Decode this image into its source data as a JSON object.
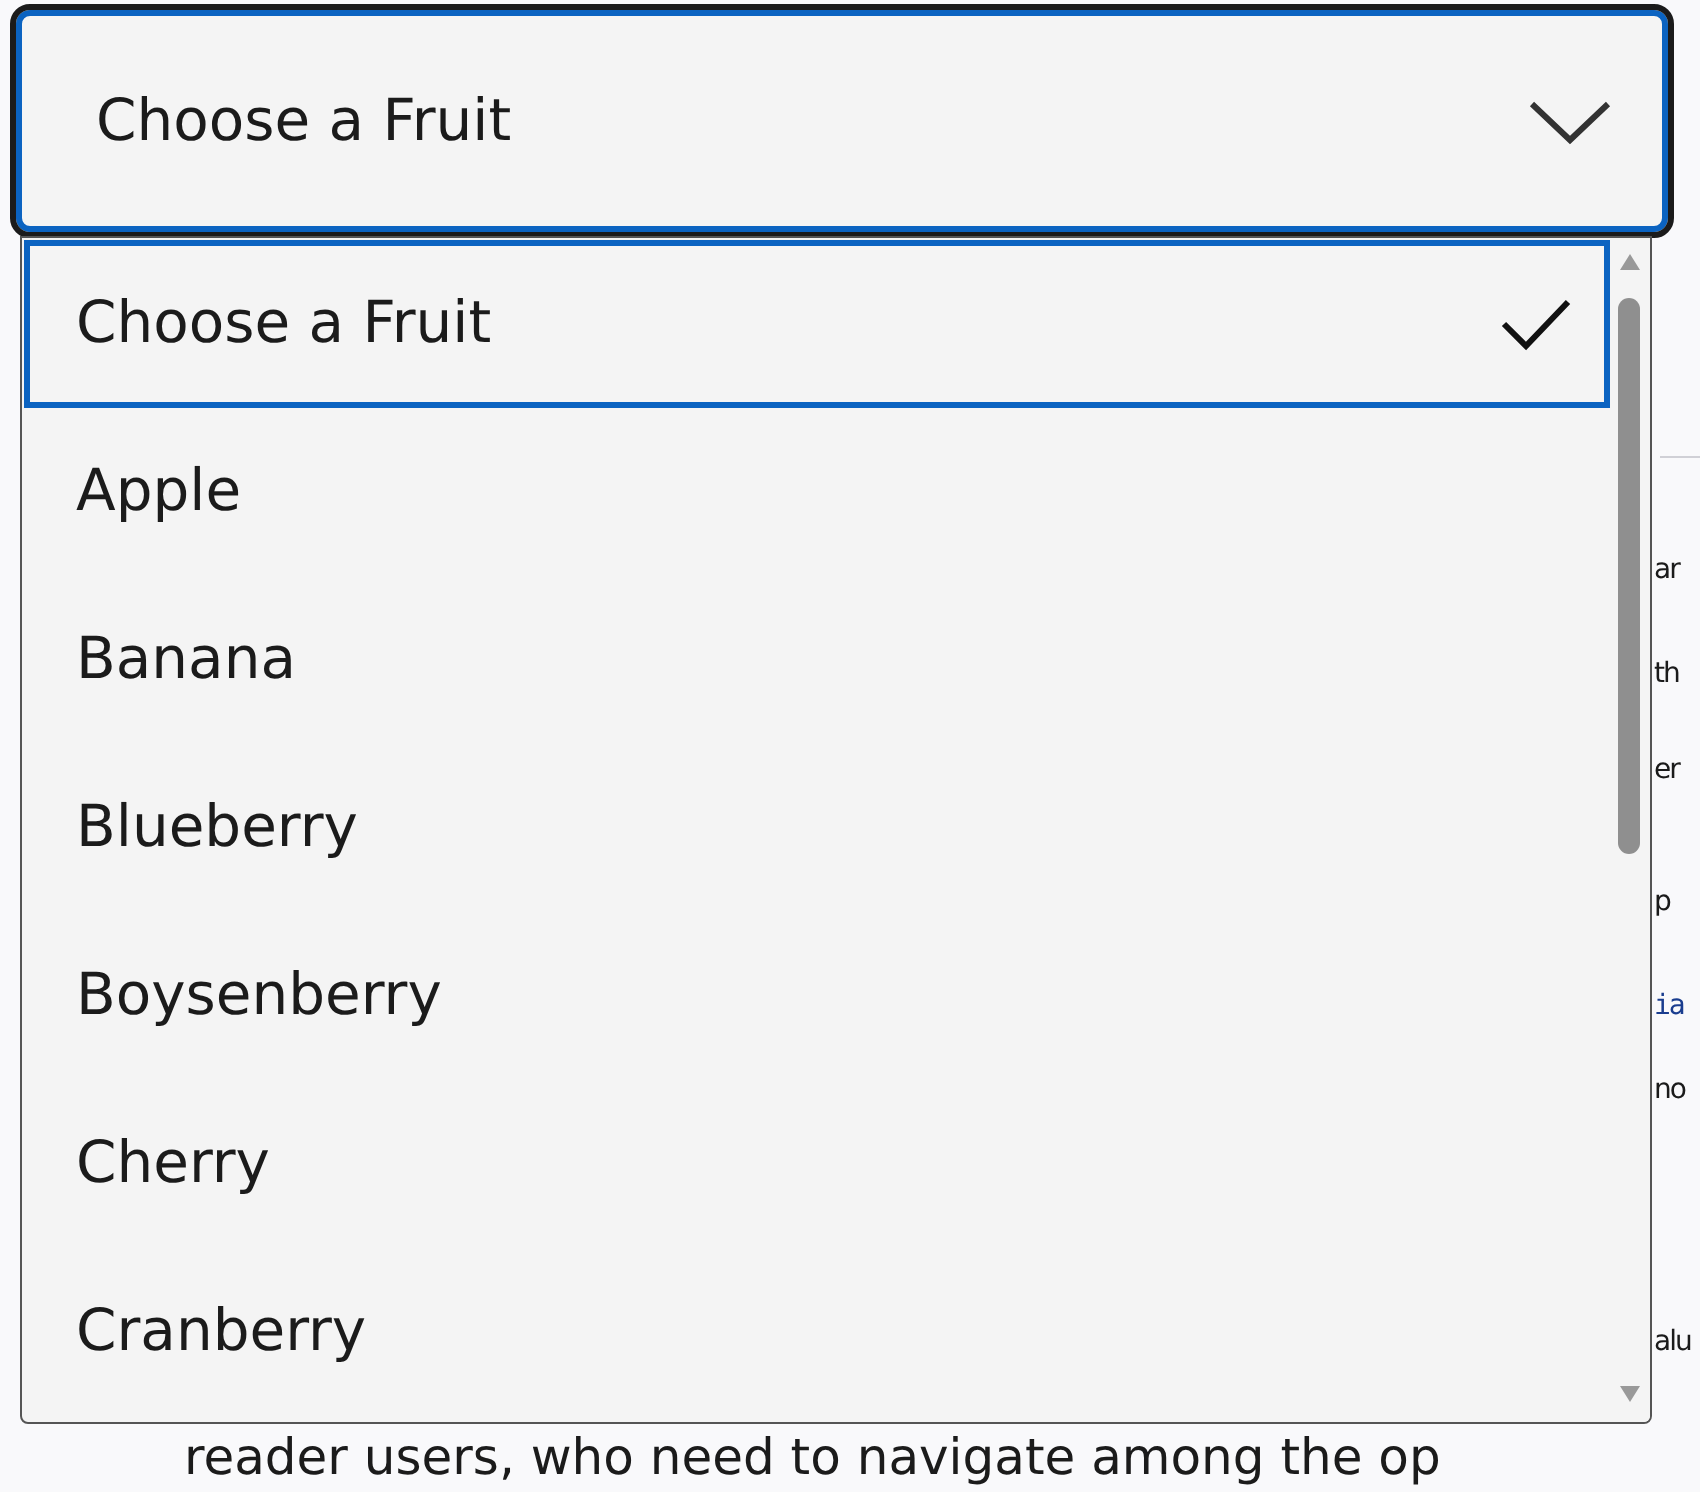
{
  "page_text": [
    {
      "text": "ar",
      "kind": "plain"
    },
    {
      "text": "th",
      "kind": "plain"
    },
    {
      "text": "er",
      "kind": "plain"
    },
    {
      "text": "p",
      "kind": "plain"
    },
    {
      "text": "ia",
      "kind": "code"
    },
    {
      "text": "no",
      "kind": "plain"
    },
    {
      "text": "alu",
      "kind": "plain"
    }
  ],
  "page_bottom_line": "reader users, who need to navigate among the op",
  "select": {
    "value": "Choose a Fruit",
    "expanded": true
  },
  "options": [
    {
      "label": "Choose a Fruit",
      "selected": true
    },
    {
      "label": "Apple",
      "selected": false
    },
    {
      "label": "Banana",
      "selected": false
    },
    {
      "label": "Blueberry",
      "selected": false
    },
    {
      "label": "Boysenberry",
      "selected": false
    },
    {
      "label": "Cherry",
      "selected": false
    },
    {
      "label": "Cranberry",
      "selected": false
    }
  ]
}
